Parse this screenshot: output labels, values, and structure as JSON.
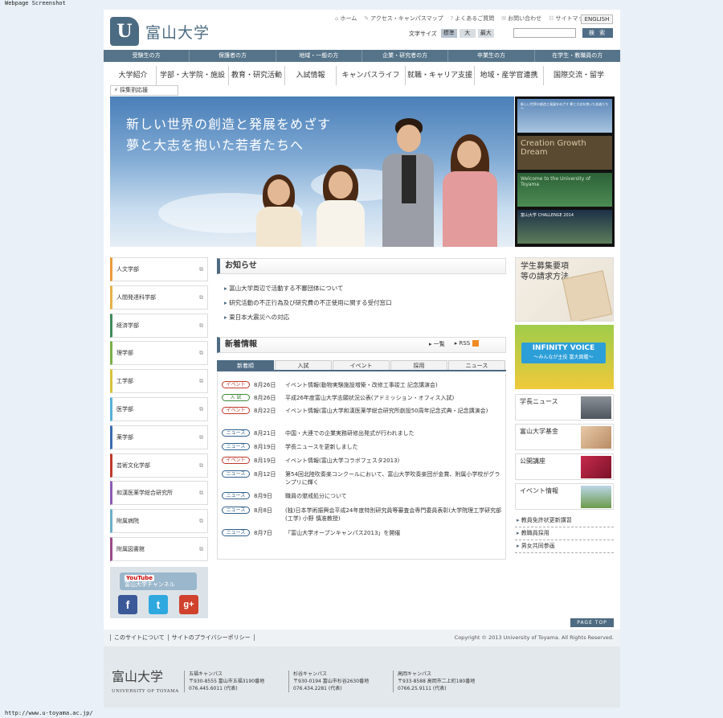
{
  "screenshot_label": "Webpage Screenshot",
  "status_url": "http://www.u-toyama.ac.jp/",
  "header": {
    "logo_mark": "U",
    "logo_text": "富山大学",
    "util_links": [
      "ホーム",
      "アクセス・キャンパスマップ",
      "よくあるご質問",
      "お問い合わせ",
      "サイトマップ"
    ],
    "english": "ENGLISH",
    "font_size_label": "文字サイズ",
    "font_sizes": [
      "標準",
      "大",
      "最大"
    ],
    "search_value": "",
    "search_button": "検 索"
  },
  "audience_nav": [
    "受験生の方",
    "保護者の方",
    "地域・一般の方",
    "企業・研究者の方",
    "卒業生の方",
    "在学生・教職員の方"
  ],
  "main_nav": [
    "大学紹介",
    "学部・大学院・施設",
    "教育・研究活動",
    "入試情報",
    "キャンパスライフ",
    "就職・キャリア支援",
    "地域・産学官連携",
    "国際交流・留学"
  ],
  "sub_nav": "採集割応援",
  "hero": {
    "line1": "新しい世界の創造と発展をめざす",
    "line2": "夢と大志を抱いた若者たちへ",
    "thumbs": [
      "新しい世界の創造と発展をめざす 夢と大志を抱いた若者たちへ",
      "Creation Growth Dream",
      "Welcome to the University of Toyama",
      "富山大学 CHALLENGE 2014"
    ]
  },
  "departments": [
    {
      "label": "人文学部",
      "color": "#e89a38"
    },
    {
      "label": "人間発達科学部",
      "color": "#e8b04a"
    },
    {
      "label": "経済学部",
      "color": "#3e8c5a"
    },
    {
      "label": "理学部",
      "color": "#7bb048"
    },
    {
      "label": "工学部",
      "color": "#d8c23a"
    },
    {
      "label": "医学部",
      "color": "#5ab0d8"
    },
    {
      "label": "薬学部",
      "color": "#3a6cb0"
    },
    {
      "label": "芸術文化学部",
      "color": "#c0392b"
    },
    {
      "label": "和漢医薬学総合研究所",
      "color": "#8a5ab0"
    },
    {
      "label": "附属病院",
      "color": "#6cb0c8"
    },
    {
      "label": "附属図書館",
      "color": "#9a4a8a"
    }
  ],
  "sns": {
    "youtube_label": "YouTube",
    "youtube_sub": "富山大学チャンネル",
    "facebook": "f",
    "twitter": "t",
    "googleplus": "g+"
  },
  "notice": {
    "title": "お知らせ",
    "items": [
      "富山大学周辺で活動する不審団体について",
      "研究活動の不正行為及び研究費の不正使用に関する受付窓口",
      "東日本大震災への対応"
    ]
  },
  "news": {
    "title": "新着情報",
    "list_link": "一覧",
    "rss": "RSS",
    "tabs": [
      "新着順",
      "入試",
      "イベント",
      "採用",
      "ニュース"
    ],
    "items": [
      {
        "badge": "イベント",
        "type": "event",
        "date": "8月26日",
        "title": "イベント情報(動物実験施設増築・改修工事竣工 記念講演会)"
      },
      {
        "badge": "入 試",
        "type": "exam",
        "date": "8月26日",
        "title": "平成26年度富山大学志願状況公表(アドミッション・オフィス入試)"
      },
      {
        "badge": "イベント",
        "type": "event",
        "date": "8月22日",
        "title": "イベント情報(富山大学和漢医薬学総合研究所創設50周年記念式典・記念講演会)"
      },
      {
        "badge": "ニュース",
        "type": "news",
        "date": "8月21日",
        "title": "中国・大連での企業実務研修出発式が行われました"
      },
      {
        "badge": "ニュース",
        "type": "news",
        "date": "8月19日",
        "title": "学長ニュースを更新しました"
      },
      {
        "badge": "イベント",
        "type": "event",
        "date": "8月19日",
        "title": "イベント情報(富山大学コラボフェスタ2013)"
      },
      {
        "badge": "ニュース",
        "type": "news",
        "date": "8月12日",
        "title": "第54回北陸吹奏楽コンクールにおいて、富山大学吹奏楽団が金賞、附属小学校がグランプリに輝く"
      },
      {
        "badge": "ニュース",
        "type": "news",
        "date": "8月9日",
        "title": "職員の懲戒処分について"
      },
      {
        "badge": "ニュース",
        "type": "news",
        "date": "8月8日",
        "title": "(独)日本学術振興会平成24年度特別研究員等審査会専門委員表彰(大学院理工学研究部(工学) 小野 慎准教授)"
      },
      {
        "badge": "ニュース",
        "type": "news",
        "date": "8月7日",
        "title": "「富山大学オープンキャンパス2013」を開催"
      }
    ]
  },
  "right": {
    "recruit": "学生募集要項等の請求方法",
    "voice_title": "INFINITY VOICE",
    "voice_sub": "～みんなが主役 富大図鑑～",
    "boxes": [
      "学長ニュース",
      "富山大学基金",
      "公開講座",
      "イベント情報"
    ],
    "links": [
      "教員免許状更新講習",
      "教職員採用",
      "男女共同参画"
    ]
  },
  "page_top": "PAGE TOP",
  "footer": {
    "links": [
      "このサイトについて",
      "サイトのプライバシーポリシー"
    ],
    "copyright": "Copyright © 2013 University of Toyama. All Rights Reserved.",
    "logo_text": "富山大学",
    "logo_sub": "UNIVERSITY OF TOYAMA",
    "campuses": [
      {
        "name": "五福キャンパス",
        "address": "〒930-8555 富山市五福3190番地",
        "tel": "076.445.6011 (代表)"
      },
      {
        "name": "杉谷キャンパス",
        "address": "〒930-0194 富山市杉谷2630番地",
        "tel": "076.434.2281 (代表)"
      },
      {
        "name": "高岡キャンパス",
        "address": "〒933-8588 高岡市二上町180番地",
        "tel": "0766.25.9111 (代表)"
      }
    ]
  }
}
